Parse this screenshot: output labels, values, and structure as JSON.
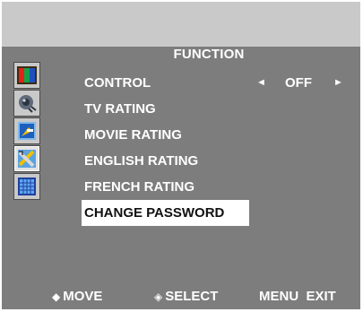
{
  "panel": {
    "title": "FUNCTION"
  },
  "sidebar": {
    "icons": [
      {
        "name": "picture-icon",
        "active": false
      },
      {
        "name": "sound-icon",
        "active": false
      },
      {
        "name": "setup-icon",
        "active": false
      },
      {
        "name": "function-tools-icon",
        "active": true
      },
      {
        "name": "grid-icon",
        "active": false
      }
    ]
  },
  "menu": {
    "items": [
      {
        "label": "CONTROL",
        "value": "OFF",
        "left_arrow": "◄",
        "right_arrow": "►"
      },
      {
        "label": "TV RATING"
      },
      {
        "label": "MOVIE RATING"
      },
      {
        "label": "ENGLISH RATING"
      },
      {
        "label": "FRENCH RATING"
      },
      {
        "label": "CHANGE PASSWORD",
        "selected": true
      }
    ]
  },
  "footer": {
    "move_glyph": "◆",
    "move": "MOVE",
    "select_glyph": "◈",
    "select": "SELECT",
    "menu_exit": "MENU  EXIT"
  },
  "colors": {
    "background": "#7d7d7d",
    "header_strip": "#c9c9c9",
    "text": "#ffffff",
    "selection": "#ffffff"
  }
}
